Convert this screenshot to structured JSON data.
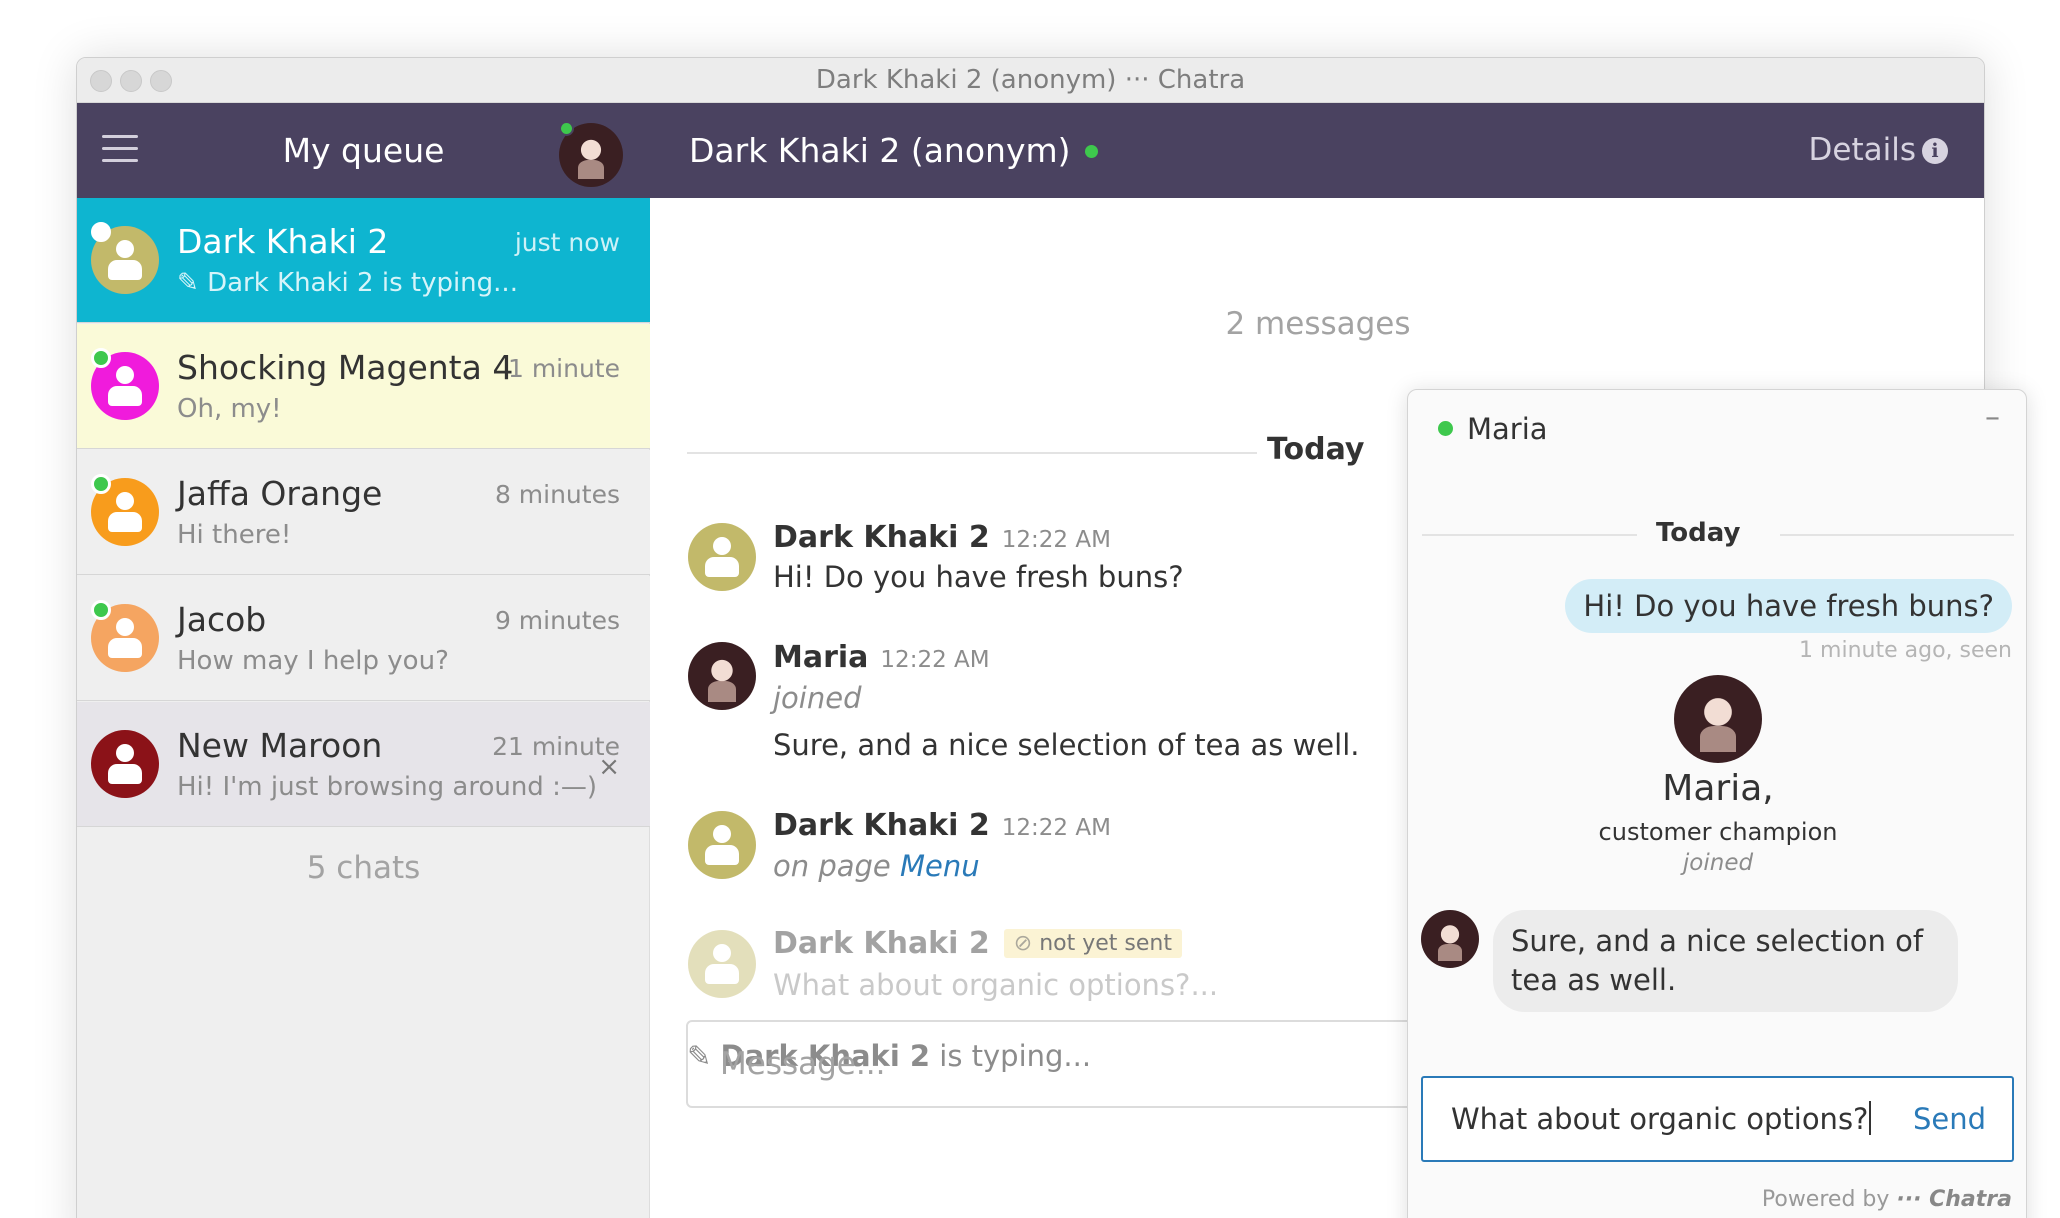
{
  "window": {
    "title": "Dark Khaki 2 (anonym) ··· Chatra"
  },
  "header": {
    "queue_title": "My queue",
    "chat_title": "Dark Khaki 2 (anonym)",
    "details_label": "Details",
    "info_symbol": "i"
  },
  "sidebar": {
    "items": [
      {
        "name": "Dark Khaki 2",
        "time": "just now",
        "message": "Dark Khaki 2 is typing...",
        "avatar_color": "#c2b96a",
        "dot_color": "#ffffff",
        "bg": "#0eb5d0",
        "active": true
      },
      {
        "name": "Shocking Magenta 4",
        "time": "1 minute",
        "message": "Oh, my!",
        "avatar_color": "#f01bdc",
        "dot_color": "#3ec84d",
        "bg": "#fafad8"
      },
      {
        "name": "Jaffa Orange",
        "time": "8 minutes",
        "message": "Hi there!",
        "avatar_color": "#f89c1c",
        "dot_color": "#3ec84d",
        "bg": "#efefef"
      },
      {
        "name": "Jacob",
        "time": "9 minutes",
        "message": "How may I help you?",
        "avatar_color": "#f5a561",
        "dot_color": "#3ec84d",
        "bg": "#efefef"
      },
      {
        "name": "New Maroon",
        "time": "21 minute",
        "message": "Hi! I'm just browsing around :—)",
        "avatar_color": "#8b1218",
        "dot_color": "",
        "bg": "#e6e4e9",
        "close": "×"
      }
    ],
    "count_label": "5 chats"
  },
  "main": {
    "messages_count": "2 messages",
    "today": "Today",
    "messages": [
      {
        "author": "Dark Khaki 2",
        "time": "12:22 AM",
        "text": "Hi! Do you have fresh buns?"
      },
      {
        "author": "Maria",
        "time": "12:22 AM",
        "status": "joined",
        "text": "Sure, and a nice selection of tea as well."
      },
      {
        "author": "Dark Khaki 2",
        "time": "12:22 AM",
        "text_prefix": "on page",
        "link": "Menu"
      },
      {
        "author": "Dark Khaki 2",
        "badge": "not yet sent",
        "text": "What about organic options?..."
      }
    ],
    "typing_name": "Dark Khaki 2",
    "typing_suffix": "is typing...",
    "message_placeholder": "Message..."
  },
  "widget": {
    "agent": "Maria",
    "minimize": "–",
    "today": "Today",
    "outgoing": "Hi! Do you have fresh buns?",
    "seen_status": "1 minute ago, seen",
    "agent_name": "Maria,",
    "agent_role": "customer champion",
    "joined": "joined",
    "incoming": "Sure, and a nice selection of tea as well.",
    "input_value": "What about organic options?",
    "send_label": "Send",
    "powered_by": "Powered by",
    "brand": "··· Chatra"
  },
  "colors": {
    "header_bg": "#4a4260",
    "accent": "#0eb5d0",
    "link": "#2a7ab8",
    "online": "#3ec84d"
  },
  "icons": [
    "hamburger-icon",
    "info-icon",
    "pencil-icon",
    "eye-slash-icon",
    "close-icon",
    "person-icon"
  ]
}
